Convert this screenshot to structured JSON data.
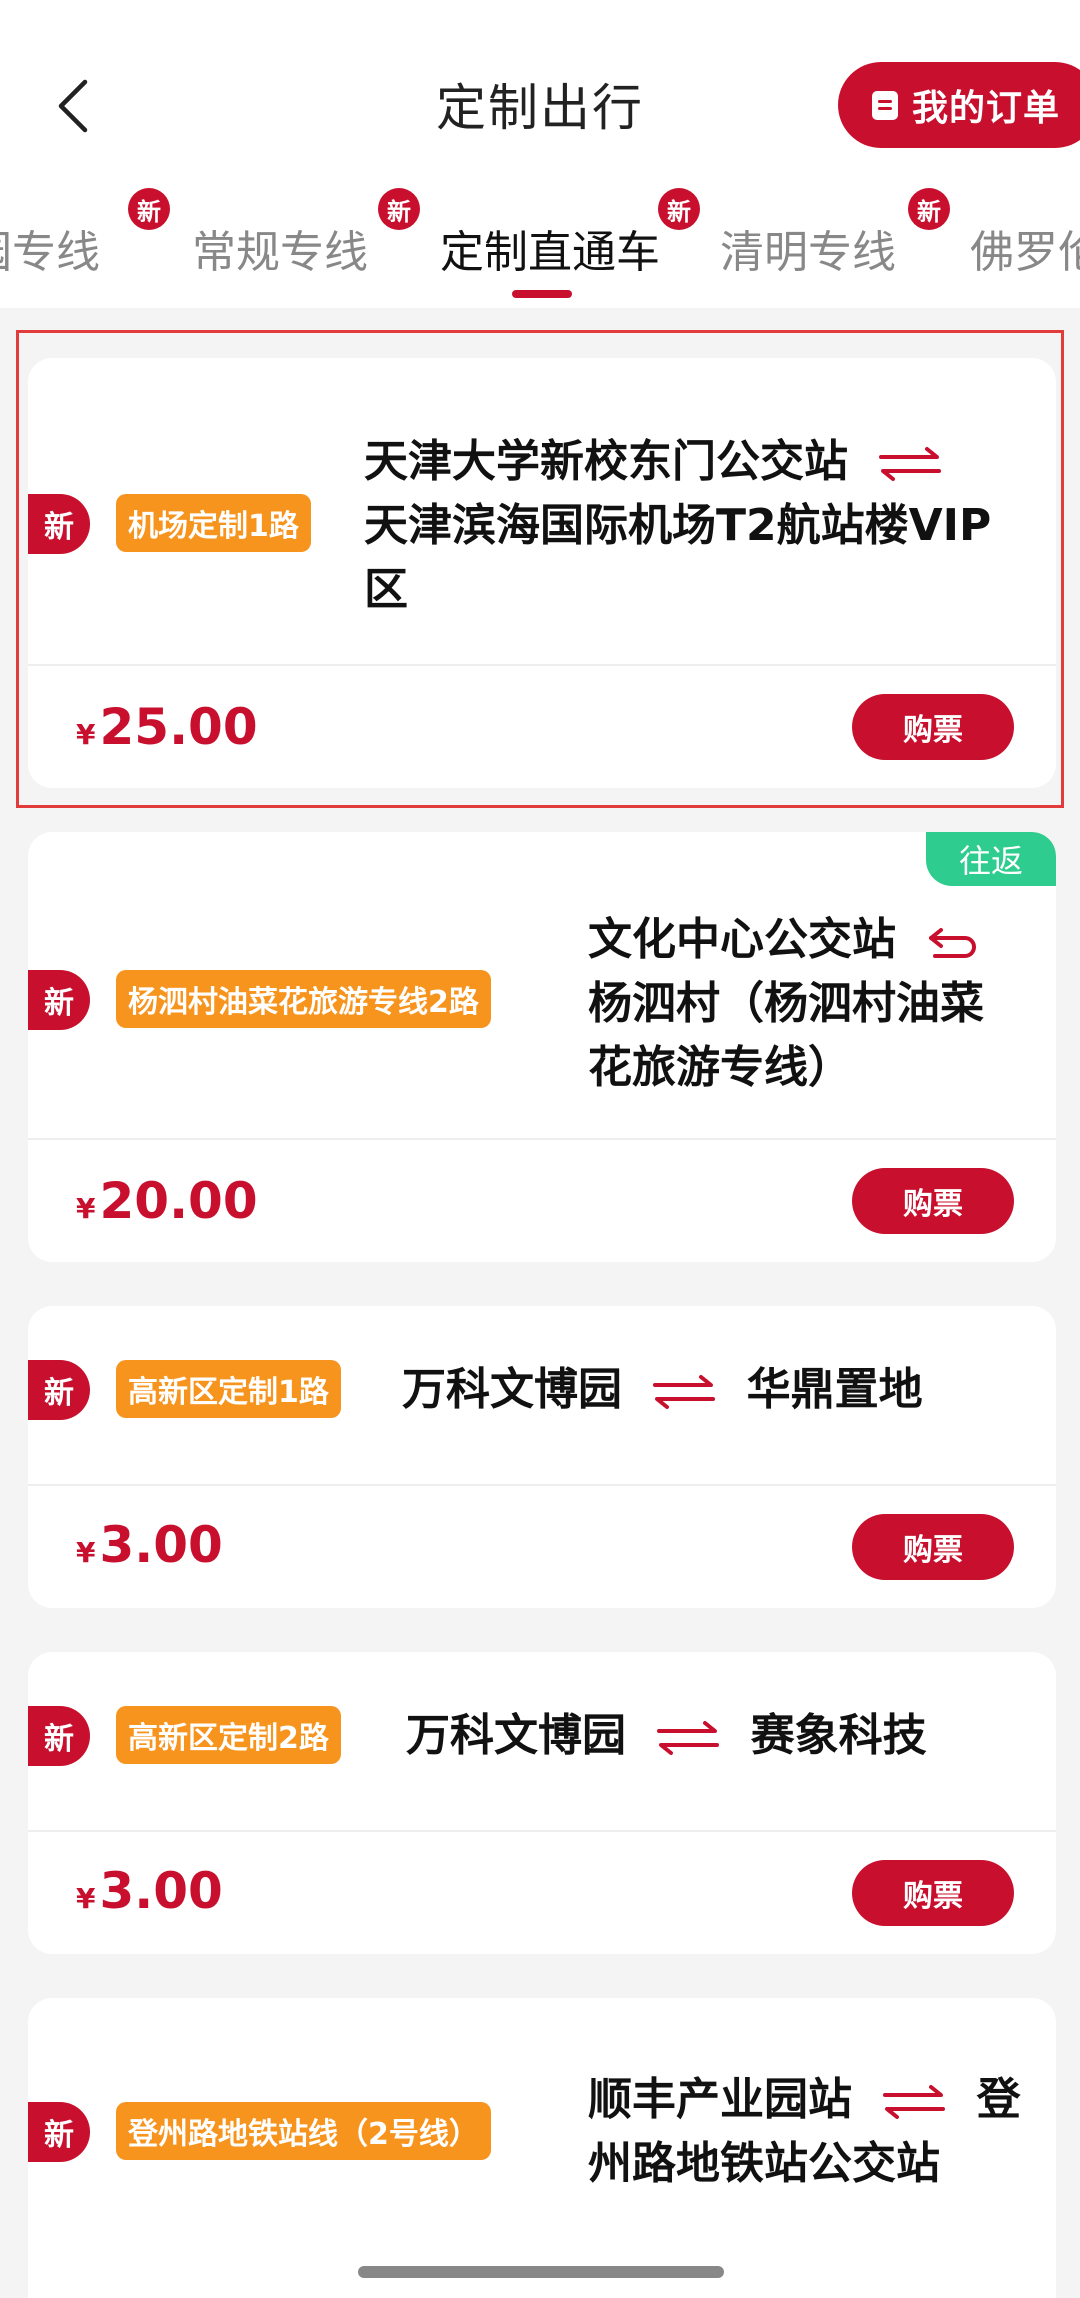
{
  "header": {
    "title": "定制出行",
    "orders_label": "我的订单"
  },
  "tabs": [
    {
      "label": "园专线",
      "new": "新"
    },
    {
      "label": "常规专线",
      "new": "新"
    },
    {
      "label": "定制直通车",
      "new": "新"
    },
    {
      "label": "清明专线",
      "new": "新"
    },
    {
      "label": "佛罗伦"
    }
  ],
  "cards": [
    {
      "new": "新",
      "route": "机场定制1路",
      "stops_line1": "天津大学新校东门公交站",
      "stops_line2": "天津滨海国际机场T2航站楼VIP",
      "stops_line3": "区",
      "price": "25.00",
      "buy": "购票"
    },
    {
      "new": "新",
      "badge": "往返",
      "route": "杨泗村油菜花旅游专线2路",
      "stops_line1": "文化中心公交站",
      "stops_line2": "杨泗村（杨泗村油菜",
      "stops_line3": "花旅游专线）",
      "price": "20.00",
      "buy": "购票"
    },
    {
      "new": "新",
      "route": "高新区定制1路",
      "from": "万科文博园",
      "to": "华鼎置地",
      "price": "3.00",
      "buy": "购票"
    },
    {
      "new": "新",
      "route": "高新区定制2路",
      "from": "万科文博园",
      "to": "赛象科技",
      "price": "3.00",
      "buy": "购票"
    },
    {
      "new": "新",
      "route": "登州路地铁站线（2号线）",
      "stops_line1_from": "顺丰产业园站",
      "stops_line1_to": "登",
      "stops_line2": "州路地铁站公交站"
    }
  ],
  "currency": "¥",
  "colors": {
    "accent": "#c8102e",
    "tag": "#f7941d",
    "badge_green": "#2ecc8f"
  }
}
